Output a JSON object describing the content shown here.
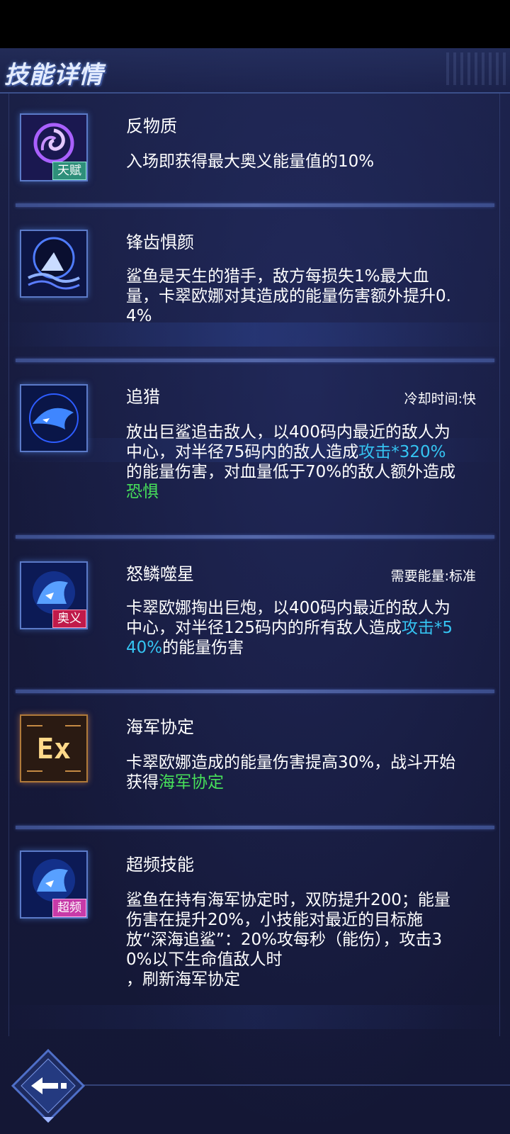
{
  "header": {
    "title": "技能详情"
  },
  "skills": [
    {
      "name": "反物质",
      "badge": "天赋",
      "icon": "antimatter-swirl-icon",
      "meta": "",
      "desc": [
        "入场即获得最大奥义能量值的10%"
      ]
    },
    {
      "name": "锋齿惧颜",
      "badge": "",
      "icon": "shark-wave-icon",
      "meta": "",
      "desc": [
        "鲨鱼是天生的猎手，敌方每损失1%最大血量，卡翠欧娜对其造成的能量伤害额外提升0.4%"
      ]
    },
    {
      "name": "追猎",
      "badge": "",
      "icon": "shark-hunt-icon",
      "meta": "冷却时间:快",
      "desc_parts": [
        {
          "text": "放出巨鲨追击敌人，以400码内最近的敌人为中心，对半径75码内的敌人造成",
          "style": ""
        },
        {
          "text": "攻击*320%",
          "style": "blue"
        },
        {
          "text": "的能量伤害，对血量低于70%的敌人额外造成",
          "style": ""
        },
        {
          "text": "恐惧",
          "style": "green"
        }
      ]
    },
    {
      "name": "怒鳞噬星",
      "badge": "奥义",
      "icon": "shark-cannon-icon",
      "meta": "需要能量:标准",
      "desc_parts": [
        {
          "text": "卡翠欧娜掏出巨炮，以400码内最近的敌人为中心，对半径125码内的所有敌人造成",
          "style": ""
        },
        {
          "text": "攻击*540%",
          "style": "blue"
        },
        {
          "text": "的能量伤害",
          "style": ""
        }
      ]
    },
    {
      "name": "海军协定",
      "badge": "",
      "icon": "ex-icon",
      "icon_text": "Ex",
      "meta": "",
      "desc_parts": [
        {
          "text": "卡翠欧娜造成的能量伤害提高30%，战斗开始获得",
          "style": ""
        },
        {
          "text": "海军协定",
          "style": "green"
        }
      ]
    },
    {
      "name": "超频技能",
      "badge": "超频",
      "icon": "shark-overclock-icon",
      "meta": "",
      "desc": [
        "鲨鱼在持有海军协定时，双防提升200；能量伤害在提升20%，小技能对最近的目标施放“深海追鲨”：20%攻每秒（能伤），攻击30%以下生命值敌人时\n，刷新海军协定"
      ]
    }
  ],
  "footer": {
    "back_icon": "back-arrow-icon"
  },
  "colors": {
    "highlight_blue": "#35c4f2",
    "highlight_green": "#47e05a"
  }
}
